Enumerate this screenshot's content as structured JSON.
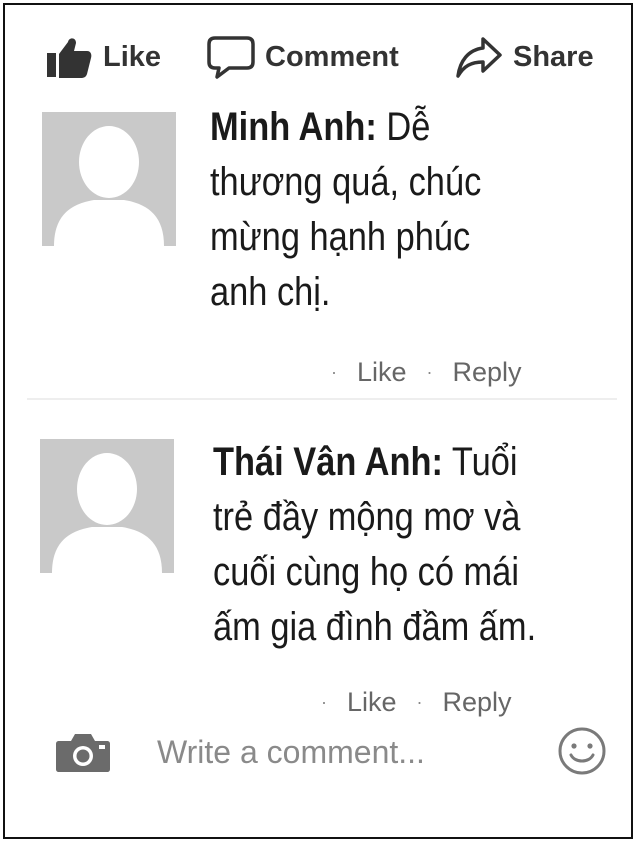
{
  "actions": {
    "like": "Like",
    "comment": "Comment",
    "share": "Share"
  },
  "comments": [
    {
      "author": "Minh Anh:",
      "lines": [
        "Dễ",
        "thương quá, chúc",
        "mừng hạnh phúc",
        "anh chị."
      ],
      "like": "Like",
      "reply": "Reply"
    },
    {
      "author": "Thái Vân Anh:",
      "lines": [
        "Tuổi",
        "trẻ đầy mộng mơ và",
        "cuối cùng họ có mái",
        "ấm gia đình đầm ấm."
      ],
      "like": "Like",
      "reply": "Reply"
    }
  ],
  "composer": {
    "placeholder": "Write a comment...",
    "camera_icon": "camera-icon",
    "emoji_icon": "smiley-icon"
  }
}
